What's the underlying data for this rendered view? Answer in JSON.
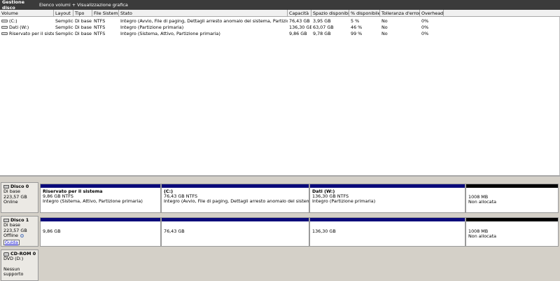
{
  "titlebar": {
    "title": "Gestione disco",
    "view": "Elenco volumi + Visualizzazione grafica"
  },
  "columns": [
    "Volume",
    "Layout",
    "Tipo",
    "File Sistema",
    "Stato",
    "Capacità",
    "Spazio disponibile",
    "% disponibile",
    "Tolleranza d'errore",
    "Overhead"
  ],
  "volumes": [
    [
      "(C:)",
      "Semplice",
      "Di base",
      "NTFS",
      "Integro (Avvio, File di paging, Dettagli arresto anomalo del sistema, Partizione primaria)",
      "76,43 GB",
      "3,95 GB",
      "5 %",
      "No",
      "0%"
    ],
    [
      "Dati (W:)",
      "Semplice",
      "Di base",
      "NTFS",
      "Integro (Partizione primaria)",
      "136,30 GB",
      "63,07 GB",
      "46 %",
      "No",
      "0%"
    ],
    [
      "Riservato per il sistema",
      "Semplice",
      "Di base",
      "NTFS",
      "Integro (Sistema, Attivo, Partizione primaria)",
      "9,86 GB",
      "9,78 GB",
      "99 %",
      "No",
      "0%"
    ]
  ],
  "disks": [
    {
      "name": "Disco 0",
      "lines": [
        "Di base",
        "223,57 GB",
        "Online"
      ],
      "partitions": [
        {
          "name": "Riservato per il sistema",
          "size": "9,86 GB NTFS",
          "status": "Integro (Sistema, Attivo, Partizione primaria)"
        },
        {
          "name": "(C:)",
          "size": "76,43 GB NTFS",
          "status": "Integro (Avvio, File di paging, Dettagli arresto anomalo del sistema, Partizio"
        },
        {
          "name": "Dati  (W:)",
          "size": "136,30 GB NTFS",
          "status": "Integro (Partizione primaria)"
        },
        {
          "name": "",
          "size": "1008 MB",
          "status": "Non allocata"
        }
      ]
    },
    {
      "name": "Disco 1",
      "lines": [
        "Di base",
        "223,57 GB",
        "Offline"
      ],
      "help": "Guida",
      "partitions": [
        {
          "size": "9,86 GB",
          "status": ""
        },
        {
          "size": "76,43 GB",
          "status": ""
        },
        {
          "size": "136,30 GB",
          "status": ""
        },
        {
          "size": "1008 MB",
          "status": "Non allocata"
        }
      ]
    },
    {
      "name": "CD-ROM 0",
      "lines": [
        "DVD (D:)",
        "",
        "Nessun supporto"
      ]
    }
  ],
  "icons": {
    "volume": "disk-volume-icon",
    "disk": "hard-disk-icon",
    "cdrom": "cdrom-icon",
    "info": "info-icon"
  },
  "colors": {
    "titlebar": "#3b3b3b",
    "primary_partition": "#0a0a7a",
    "unallocated": "#000000",
    "graph_bg": "#d4d0c8"
  }
}
